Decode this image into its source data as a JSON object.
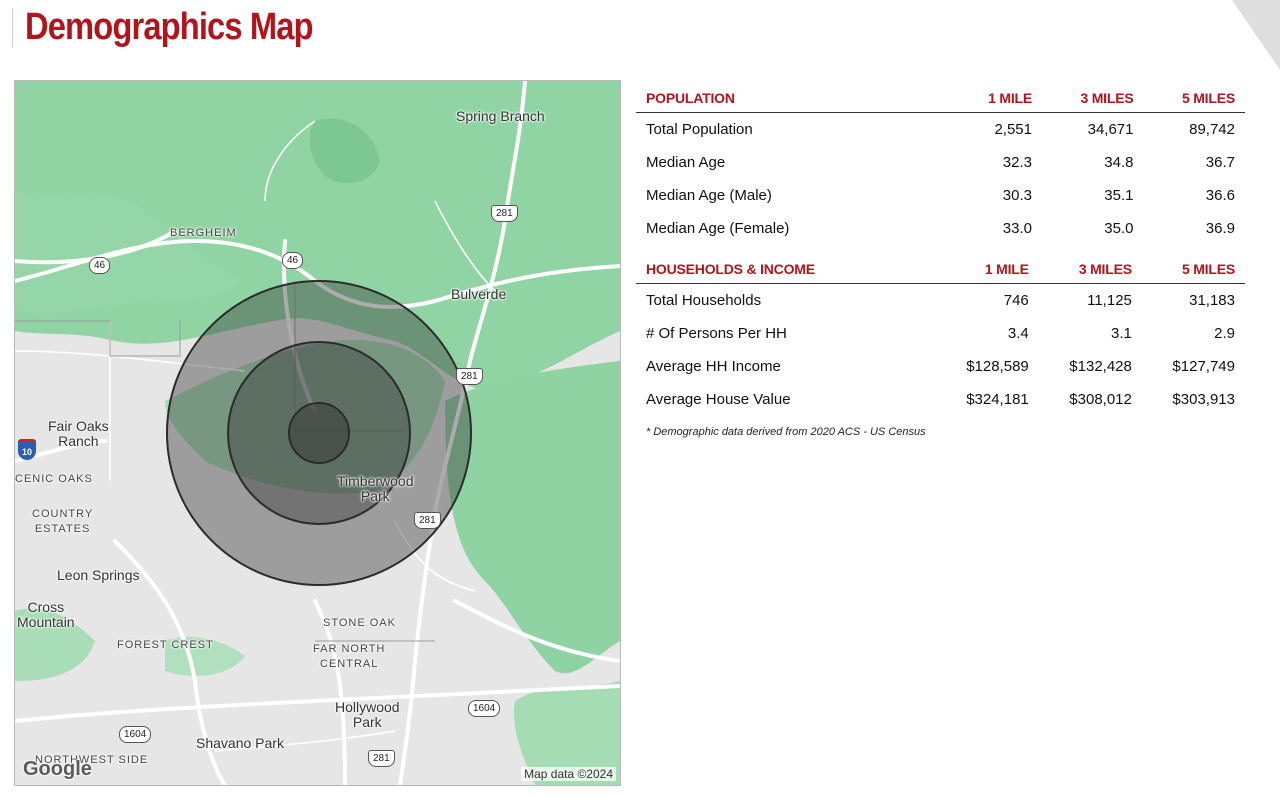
{
  "page": {
    "title": "Demographics Map"
  },
  "map": {
    "labels": {
      "spring_branch": "Spring Branch",
      "bergheim": "BERGHEIM",
      "bulverde": "Bulverde",
      "fair_oaks_ranch": "Fair Oaks\nRanch",
      "scenic_oaks": "CENIC OAKS",
      "country_estates": "COUNTRY\nESTATES",
      "timberwood_park": "Timberwood\nPark",
      "leon_springs": "Leon Springs",
      "cross_mountain": "Cross\nMountain",
      "forest_crest": "FOREST CREST",
      "stone_oak": "STONE OAK",
      "far_north_central": "FAR NORTH\nCENTRAL",
      "hollywood_park": "Hollywood\nPark",
      "shavano_park": "Shavano Park",
      "northwest_side": "NORTHWEST SIDE"
    },
    "shields": {
      "us281_a": "281",
      "us281_b": "281",
      "us281_c": "281",
      "us281_d": "281",
      "sh46_a": "46",
      "sh46_b": "46",
      "lp1604_a": "1604",
      "lp1604_b": "1604",
      "i10": "10"
    },
    "logo": "Google",
    "attribution": "Map data ©2024",
    "colors": {
      "park_green": "#8fd6a4",
      "terrain_gray": "#dcdcdc",
      "road_white": "#ffffff",
      "ring_fill": "#3a3a3a",
      "ring_stroke": "#2b2b2b"
    }
  },
  "population_table": {
    "header": [
      "POPULATION",
      "1 MILE",
      "3 MILES",
      "5 MILES"
    ],
    "rows": [
      [
        "Total Population",
        "2,551",
        "34,671",
        "89,742"
      ],
      [
        "Median Age",
        "32.3",
        "34.8",
        "36.7"
      ],
      [
        "Median Age (Male)",
        "30.3",
        "35.1",
        "36.6"
      ],
      [
        "Median Age (Female)",
        "33.0",
        "35.0",
        "36.9"
      ]
    ]
  },
  "households_table": {
    "header": [
      "HOUSEHOLDS & INCOME",
      "1 MILE",
      "3 MILES",
      "5 MILES"
    ],
    "rows": [
      [
        "Total Households",
        "746",
        "11,125",
        "31,183"
      ],
      [
        "# Of Persons Per HH",
        "3.4",
        "3.1",
        "2.9"
      ],
      [
        "Average HH Income",
        "$128,589",
        "$132,428",
        "$127,749"
      ],
      [
        "Average House Value",
        "$324,181",
        "$308,012",
        "$303,913"
      ]
    ]
  },
  "footnote": "* Demographic data derived from 2020 ACS - US Census",
  "theme": {
    "accent": "#b3141b"
  }
}
